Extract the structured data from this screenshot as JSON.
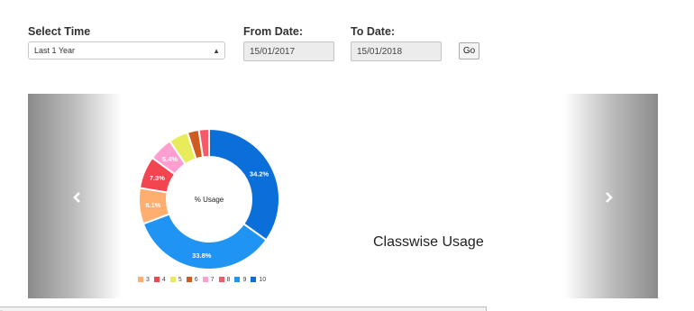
{
  "filters": {
    "select_time_label": "Select Time",
    "select_time_value": "Last 1 Year",
    "from_label": "From Date:",
    "from_value": "15/01/2017",
    "to_label": "To Date:",
    "to_value": "15/01/2018",
    "go_label": "Go"
  },
  "carousel": {
    "prev_icon": "chevron-left-icon",
    "next_icon": "chevron-right-icon",
    "title": "Classwise Usage"
  },
  "chart_data": {
    "type": "pie",
    "center_label": "% Usage",
    "donut": true,
    "slices": [
      {
        "label": "3",
        "value": 8.1,
        "color": "#ffae70",
        "show_label": "8.1%"
      },
      {
        "label": "4",
        "value": 7.3,
        "color": "#f2454f",
        "show_label": "7.3%"
      },
      {
        "label": "5",
        "value": 4.4,
        "color": "#e8ec5a",
        "show_label": ""
      },
      {
        "label": "6",
        "value": 2.6,
        "color": "#cf5b1f",
        "show_label": ""
      },
      {
        "label": "7",
        "value": 5.4,
        "color": "#ff9ed1",
        "show_label": "5.4%"
      },
      {
        "label": "8",
        "value": 2.3,
        "color": "#f45a6a",
        "show_label": ""
      },
      {
        "label": "9",
        "value": 33.8,
        "color": "#2094f3",
        "show_label": "33.8%"
      },
      {
        "label": "10",
        "value": 34.2,
        "color": "#0a6fd9",
        "show_label": "34.2%"
      }
    ],
    "draw_order": [
      "10",
      "9",
      "3",
      "4",
      "7",
      "5",
      "6",
      "8"
    ],
    "legend_position": "bottom"
  },
  "status_bar": {
    "text": "..."
  }
}
